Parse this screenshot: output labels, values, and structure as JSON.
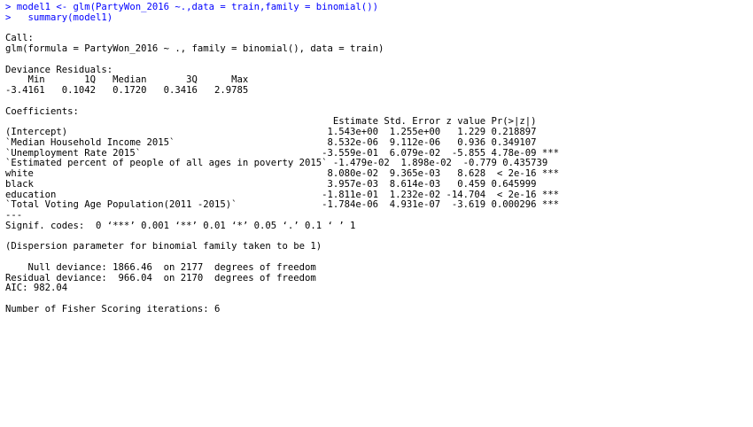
{
  "console": {
    "input_color": "#0000ff",
    "output_color": "#000000",
    "commands": [
      "> model1 <- glm(PartyWon_2016 ~.,data = train,family = binomial())",
      ">   summary(model1)"
    ],
    "call_header": "Call:",
    "call_text": "glm(formula = PartyWon_2016 ~ ., family = binomial(), data = train)",
    "deviance_header": "Deviance Residuals:",
    "deviance_labels": "    Min       1Q   Median       3Q      Max  ",
    "deviance_values": "-3.4161   0.1042   0.1720   0.3416   2.9785  ",
    "coef_header": "Coefficients:",
    "coef_columns": "                                                          Estimate Std. Error z value Pr(>|z|)    ",
    "coef_rows": [
      "(Intercept)                                              1.543e+00  1.255e+00   1.229 0.218897    ",
      "`Median Household Income 2015`                           8.532e-06  9.112e-06   0.936 0.349107    ",
      "`Unemployment Rate 2015`                                -3.559e-01  6.079e-02  -5.855 4.78e-09 ***",
      "`Estimated percent of people of all ages in poverty 2015` -1.479e-02  1.898e-02  -0.779 0.435739    ",
      "white                                                    8.080e-02  9.365e-03   8.628  < 2e-16 ***",
      "black                                                    3.957e-03  8.614e-03   0.459 0.645999    ",
      "education                                               -1.811e-01  1.232e-02 -14.704  < 2e-16 ***",
      "`Total Voting Age Population(2011 -2015)`               -1.784e-06  4.931e-07  -3.619 0.000296 ***"
    ],
    "separator": "---",
    "signif_codes": "Signif. codes:  0 ‘***’ 0.001 ‘**’ 0.01 ‘*’ 0.05 ‘.’ 0.1 ‘ ’ 1",
    "dispersion": "(Dispersion parameter for binomial family taken to be 1)",
    "null_deviance": "    Null deviance: 1866.46  on 2177  degrees of freedom",
    "residual_deviance": "Residual deviance:  966.04  on 2170  degrees of freedom",
    "aic": "AIC: 982.04",
    "fisher": "Number of Fisher Scoring iterations: 6"
  }
}
